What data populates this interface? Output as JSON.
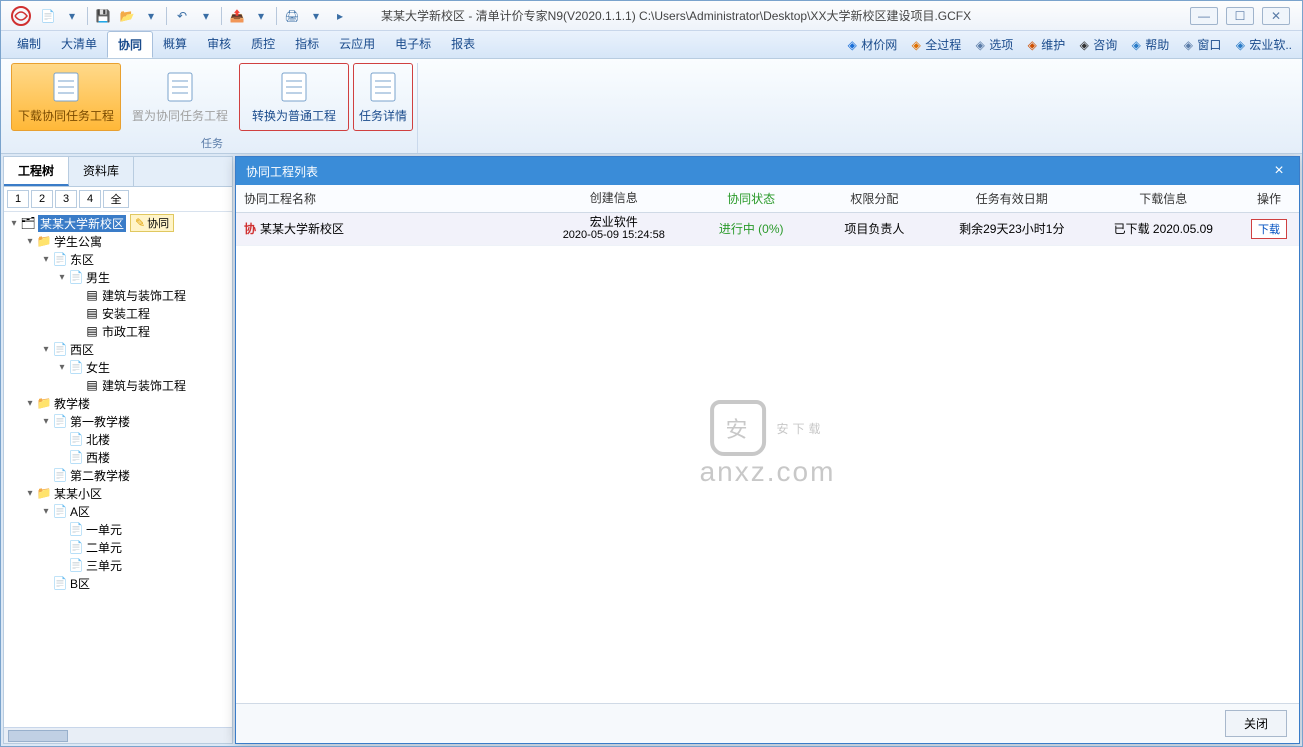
{
  "title": "某某大学新校区 - 清单计价专家N9(V2020.1.1.1) C:\\Users\\Administrator\\Desktop\\XX大学新校区建设项目.GCFX",
  "menu": [
    "编制",
    "大清单",
    "协同",
    "概算",
    "审核",
    "质控",
    "指标",
    "云应用",
    "电子标",
    "报表"
  ],
  "active_menu_index": 2,
  "menu_right": [
    {
      "icon": "price-icon",
      "label": "材价网",
      "color": "#1a6fd8"
    },
    {
      "icon": "process-icon",
      "label": "全过程",
      "color": "#e07000"
    },
    {
      "icon": "gear-icon",
      "label": "选项",
      "color": "#5a7ca8"
    },
    {
      "icon": "wrench-icon",
      "label": "维护",
      "color": "#d05000"
    },
    {
      "icon": "qq-icon",
      "label": "咨询",
      "color": "#333"
    },
    {
      "icon": "help-icon",
      "label": "帮助",
      "color": "#2a7cc8"
    },
    {
      "icon": "window-icon",
      "label": "窗口",
      "color": "#5a7ca8"
    },
    {
      "icon": "user-icon",
      "label": "宏业软..",
      "color": "#2a7cc8"
    }
  ],
  "ribbon": {
    "buttons": [
      {
        "label": "下载协同任务工程",
        "state": "active"
      },
      {
        "label": "置为协同任务工程",
        "state": "disabled"
      },
      {
        "label": "转换为普通工程",
        "state": "red-border"
      },
      {
        "label": "任务详情",
        "state": "red-border small"
      }
    ],
    "group_label": "任务"
  },
  "left": {
    "tabs": [
      "工程树",
      "资料库"
    ],
    "active_tab": 0,
    "num_tabs": [
      "1",
      "2",
      "3",
      "4",
      "全"
    ],
    "tree": [
      {
        "d": 0,
        "tw": "▾",
        "ic": "project",
        "label": "某某大学新校区",
        "sel": true,
        "badge": "协同"
      },
      {
        "d": 1,
        "tw": "▾",
        "ic": "folder",
        "label": "学生公寓"
      },
      {
        "d": 2,
        "tw": "▾",
        "ic": "doc",
        "label": "东区"
      },
      {
        "d": 3,
        "tw": "▾",
        "ic": "doc",
        "label": "男生"
      },
      {
        "d": 4,
        "tw": "",
        "ic": "sheet",
        "label": "建筑与装饰工程"
      },
      {
        "d": 4,
        "tw": "",
        "ic": "sheet",
        "label": "安装工程"
      },
      {
        "d": 4,
        "tw": "",
        "ic": "sheet",
        "label": "市政工程"
      },
      {
        "d": 2,
        "tw": "▾",
        "ic": "doc",
        "label": "西区"
      },
      {
        "d": 3,
        "tw": "▾",
        "ic": "doc",
        "label": "女生"
      },
      {
        "d": 4,
        "tw": "",
        "ic": "sheet",
        "label": "建筑与装饰工程"
      },
      {
        "d": 1,
        "tw": "▾",
        "ic": "folder",
        "label": "教学楼"
      },
      {
        "d": 2,
        "tw": "▾",
        "ic": "doc",
        "label": "第一教学楼"
      },
      {
        "d": 3,
        "tw": "",
        "ic": "doc",
        "label": "北楼"
      },
      {
        "d": 3,
        "tw": "",
        "ic": "doc",
        "label": "西楼"
      },
      {
        "d": 2,
        "tw": "",
        "ic": "doc",
        "label": "第二教学楼"
      },
      {
        "d": 1,
        "tw": "▾",
        "ic": "folder",
        "label": "某某小区"
      },
      {
        "d": 2,
        "tw": "▾",
        "ic": "doc",
        "label": "A区"
      },
      {
        "d": 3,
        "tw": "",
        "ic": "doc",
        "label": "一单元"
      },
      {
        "d": 3,
        "tw": "",
        "ic": "doc",
        "label": "二单元"
      },
      {
        "d": 3,
        "tw": "",
        "ic": "doc",
        "label": "三单元"
      },
      {
        "d": 2,
        "tw": "",
        "ic": "doc",
        "label": "B区"
      }
    ]
  },
  "dialog": {
    "title": "协同工程列表",
    "headers": [
      "协同工程名称",
      "创建信息",
      "协同状态",
      "权限分配",
      "任务有效日期",
      "下载信息",
      "操作"
    ],
    "row": {
      "name": "某某大学新校区",
      "create_top": "宏业软件",
      "create_bot": "2020-05-09 15:24:58",
      "status": "进行中 (0%)",
      "role": "项目负责人",
      "expire": "剩余29天23小时1分",
      "dl": "已下载  2020.05.09",
      "op": "下载"
    },
    "close_btn": "关闭"
  },
  "watermark": {
    "top": "安下载",
    "bot": "anxz.com"
  }
}
